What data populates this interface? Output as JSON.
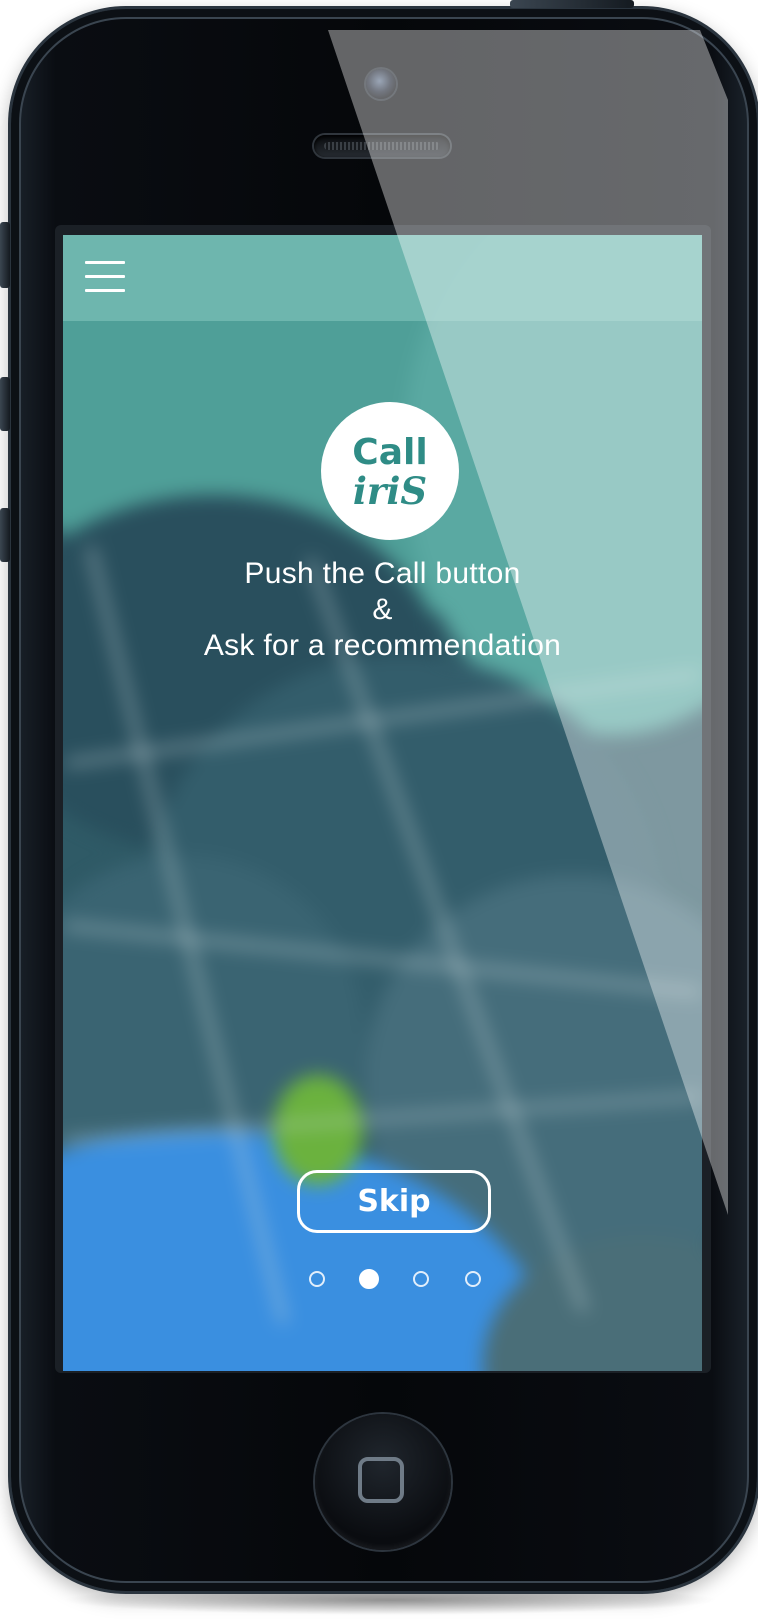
{
  "header": {
    "menu_icon": "hamburger-menu-icon"
  },
  "logo": {
    "line1": "Call",
    "line2": "iriS"
  },
  "tagline": {
    "line1": "Push the Call button",
    "line2": "&",
    "line3": "Ask for a recommendation"
  },
  "skip_label": "Skip",
  "pagination": {
    "total": 4,
    "active_index": 1
  },
  "colors": {
    "header_teal": "#78beb6",
    "brand_teal": "#2f8c86",
    "ocean_blue": "#3a8fe0"
  }
}
